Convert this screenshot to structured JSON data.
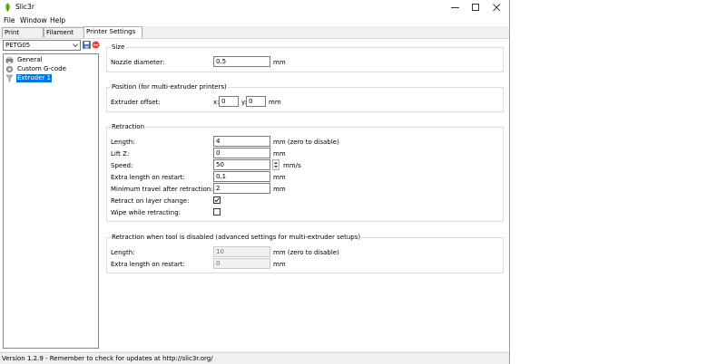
{
  "window": {
    "title": "Slic3r"
  },
  "menu": [
    {
      "label": "File"
    },
    {
      "label": "Window"
    },
    {
      "label": "Help"
    }
  ],
  "tabs": [
    {
      "label": "Print Settings"
    },
    {
      "label": "Filament Settings"
    },
    {
      "label": "Printer Settings",
      "active": true
    }
  ],
  "preset": {
    "selected": "PETG05"
  },
  "tree": [
    {
      "label": "General",
      "icon": "printer-icon"
    },
    {
      "label": "Custom G-code",
      "icon": "cog-icon"
    },
    {
      "label": "Extruder 1",
      "icon": "funnel-icon",
      "selected": true
    }
  ],
  "size": {
    "title": "Size",
    "nozzle_label": "Nozzle diameter:",
    "nozzle_value": "0.5",
    "nozzle_unit": "mm"
  },
  "position": {
    "title": "Position (for multi-extruder printers)",
    "offset_label": "Extruder offset:",
    "x_label": "x:",
    "x_value": "0",
    "y_label": "y:",
    "y_value": "0",
    "unit": "mm"
  },
  "retraction": {
    "title": "Retraction",
    "length_label": "Length:",
    "length_value": "4",
    "length_unit": "mm (zero to disable)",
    "liftz_label": "Lift Z:",
    "liftz_value": "0",
    "liftz_unit": "mm",
    "speed_label": "Speed:",
    "speed_value": "50",
    "speed_unit": "mm/s",
    "extra_label": "Extra length on restart:",
    "extra_value": "0.1",
    "extra_unit": "mm",
    "travel_label": "Minimum travel after retraction:",
    "travel_value": "2",
    "travel_unit": "mm",
    "layer_change_label": "Retract on layer change:",
    "layer_change_checked": true,
    "wipe_label": "Wipe while retracting:",
    "wipe_checked": false
  },
  "disabled_tool": {
    "title": "Retraction when tool is disabled (advanced settings for multi-extruder setups)",
    "length_label": "Length:",
    "length_value": "10",
    "length_unit": "mm (zero to disable)",
    "extra_label": "Extra length on restart:",
    "extra_value": "0",
    "extra_unit": "mm"
  },
  "status": {
    "text": "Version 1.2.9 - Remember to check for updates at http://slic3r.org/"
  }
}
